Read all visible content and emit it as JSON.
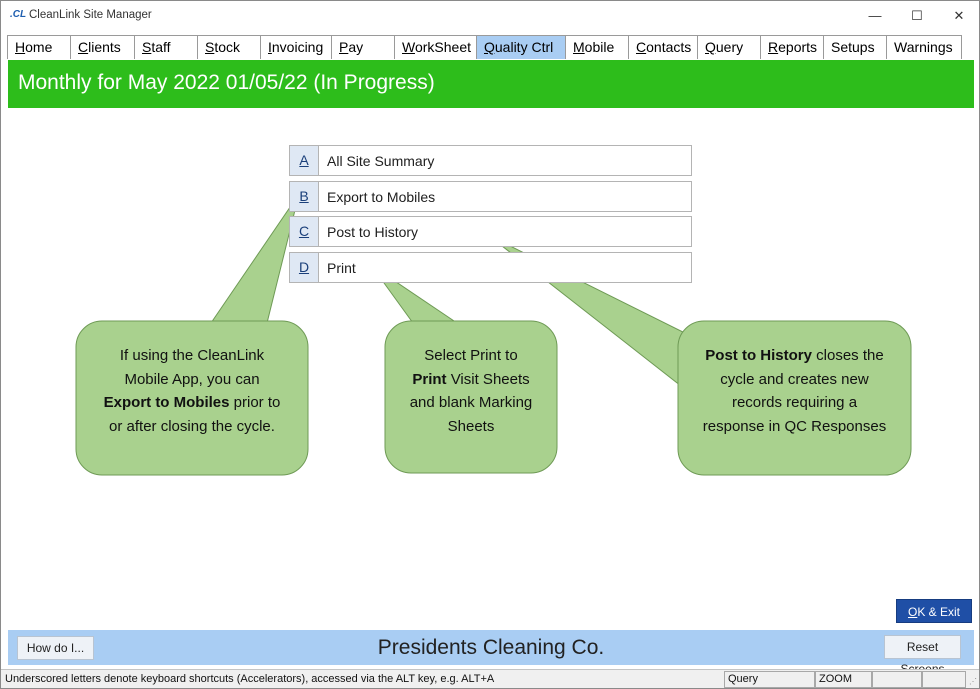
{
  "window": {
    "logo": ".CL",
    "title": "CleanLink Site Manager",
    "minimize_glyph": "—",
    "maximize_glyph": "☐",
    "close_glyph": "✕"
  },
  "tabs": [
    {
      "label": "Home",
      "underline": "H",
      "rest": "ome"
    },
    {
      "label": "Clients",
      "underline": "C",
      "rest": "lients"
    },
    {
      "label": "Staff",
      "underline": "S",
      "rest": "taff"
    },
    {
      "label": "Stock",
      "underline": "S",
      "rest": "tock"
    },
    {
      "label": "Invoicing",
      "underline": "I",
      "rest": "nvoicing"
    },
    {
      "label": "Pay",
      "underline": "P",
      "rest": "ay"
    },
    {
      "label": "WorkSheet",
      "underline": "W",
      "rest": "orkSheet"
    },
    {
      "label": "Quality Ctrl",
      "underline": "Q",
      "rest": "uality Ctrl"
    },
    {
      "label": "Mobile",
      "underline": "M",
      "rest": "obile"
    },
    {
      "label": "Contacts",
      "underline": "C",
      "rest": "ontacts"
    },
    {
      "label": "Query",
      "underline": "Q",
      "rest": "uery"
    },
    {
      "label": "Reports",
      "underline": "R",
      "rest": "eports"
    },
    {
      "label": "Setups",
      "underline": "",
      "rest": "Setups"
    },
    {
      "label": "Warnings",
      "underline": "",
      "rest": "Warnings"
    }
  ],
  "active_tab": "Quality Ctrl",
  "header": {
    "title": "Monthly for May 2022 01/05/22  (In Progress)",
    "color": "#2dbd1b"
  },
  "menu": [
    {
      "key": "A",
      "label": "All Site Summary"
    },
    {
      "key": "B",
      "label": "Export to Mobiles"
    },
    {
      "key": "C",
      "label": "Post to History"
    },
    {
      "key": "D",
      "label": "Print"
    }
  ],
  "callouts": {
    "export": {
      "line1": "If using the CleanLink",
      "line2": "Mobile App, you can",
      "bold": "Export to Mobiles",
      "line3_rest": " prior to",
      "line4": "or after closing the cycle."
    },
    "print": {
      "line1": "Select Print to",
      "bold": "Print",
      "line2_rest": " Visit Sheets",
      "line3": "and blank Marking",
      "line4": "Sheets"
    },
    "history": {
      "bold": "Post to History",
      "line1_rest": " closes the",
      "line2": "cycle and creates new",
      "line3": "records requiring a",
      "line4": "response in QC Responses"
    },
    "fill_color": "#a9d18e",
    "border_color": "#6e9a55"
  },
  "ok_button": {
    "underline": "O",
    "rest": "K & Exit"
  },
  "footer": {
    "how_do_label": "How do I...",
    "company": "Presidents Cleaning Co.",
    "reset_label": "Reset Screens"
  },
  "statusbar": {
    "hint": "Underscored letters denote keyboard shortcuts (Accelerators), accessed via the ALT key, e.g. ALT+A",
    "mode": "Query",
    "zoom": "ZOOM",
    "grip_glyph": "⋰"
  }
}
